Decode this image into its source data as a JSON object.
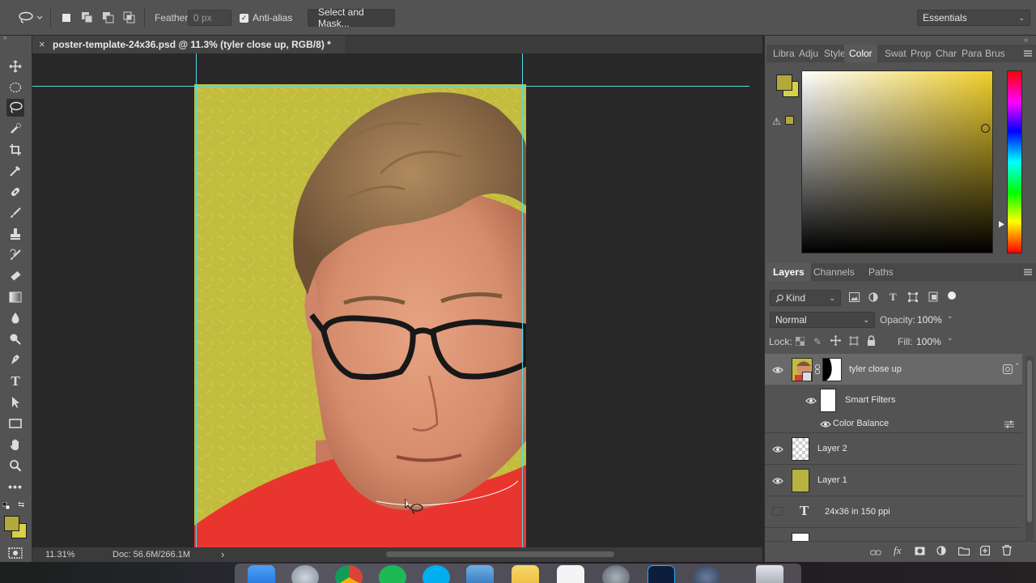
{
  "options_bar": {
    "feather_label": "Feather:",
    "feather_value": "0 px",
    "anti_alias_label": "Anti-alias",
    "anti_alias_checked": true,
    "select_mask_label": "Select and Mask...",
    "workspace": "Essentials"
  },
  "document": {
    "tab_title": "poster-template-24x36.psd @ 11.3% (tyler close up, RGB/8) *",
    "close_glyph": "×"
  },
  "status": {
    "zoom": "11.31%",
    "doc_size": "Doc: 56.6M/266.1M",
    "arrow": "›"
  },
  "tools": [
    "move-tool",
    "marquee-tool",
    "lasso-tool",
    "quick-selection-tool",
    "crop-tool",
    "eyedropper-tool",
    "healing-brush-tool",
    "brush-tool",
    "clone-stamp-tool",
    "history-brush-tool",
    "eraser-tool",
    "gradient-tool",
    "blur-tool",
    "dodge-tool",
    "pen-tool",
    "type-tool",
    "path-selection-tool",
    "rectangle-tool",
    "hand-tool",
    "zoom-tool",
    "more-tools"
  ],
  "colors": {
    "foreground": "#b3a83a",
    "background": "#d6d04a",
    "picker_hue": "#f0cf2a",
    "artboard": "#c2bd3f",
    "guide": "#52d8e8",
    "shirt": "#e8352e"
  },
  "color_panel": {
    "tabs": [
      "Libra",
      "Adju",
      "Style",
      "Color",
      "Swat",
      "Prop",
      "Char",
      "Para",
      "Brus"
    ],
    "active_tab": "Color"
  },
  "layers_panel": {
    "tabs": [
      "Layers",
      "Channels",
      "Paths"
    ],
    "active_tab": "Layers",
    "filter_kind": "Kind",
    "blend_mode": "Normal",
    "opacity_label": "Opacity:",
    "opacity_value": "100%",
    "lock_label": "Lock:",
    "fill_label": "Fill:",
    "fill_value": "100%",
    "layers": [
      {
        "name": "tyler close up",
        "visible": true,
        "selected": true
      },
      {
        "name": "Smart Filters",
        "visible": true
      },
      {
        "name": "Color Balance",
        "visible": true
      },
      {
        "name": "Layer 2",
        "visible": true
      },
      {
        "name": "Layer 1",
        "visible": true
      },
      {
        "name": "24x36 in  150 ppi",
        "visible": false
      }
    ]
  }
}
